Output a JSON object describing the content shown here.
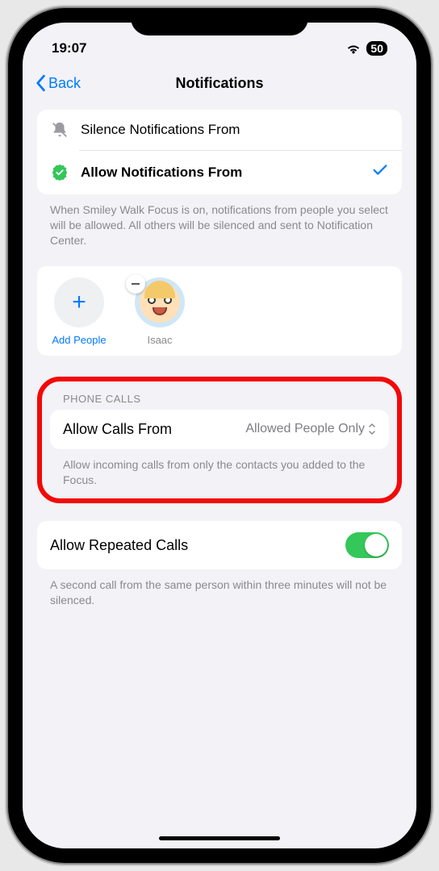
{
  "status": {
    "time": "19:07",
    "battery": "50"
  },
  "nav": {
    "back": "Back",
    "title": "Notifications"
  },
  "modes": {
    "silence": "Silence Notifications From",
    "allow": "Allow Notifications From",
    "footer": "When Smiley Walk Focus is on, notifications from people you select will be allowed. All others will be silenced and sent to Notification Center."
  },
  "people": {
    "add": "Add People",
    "items": [
      {
        "name": "Isaac"
      }
    ]
  },
  "calls": {
    "header": "PHONE CALLS",
    "label": "Allow Calls From",
    "value": "Allowed People Only",
    "footer": "Allow incoming calls from only the contacts you added to the Focus."
  },
  "repeated": {
    "label": "Allow Repeated Calls",
    "enabled": true,
    "footer": "A second call from the same person within three minutes will not be silenced."
  }
}
